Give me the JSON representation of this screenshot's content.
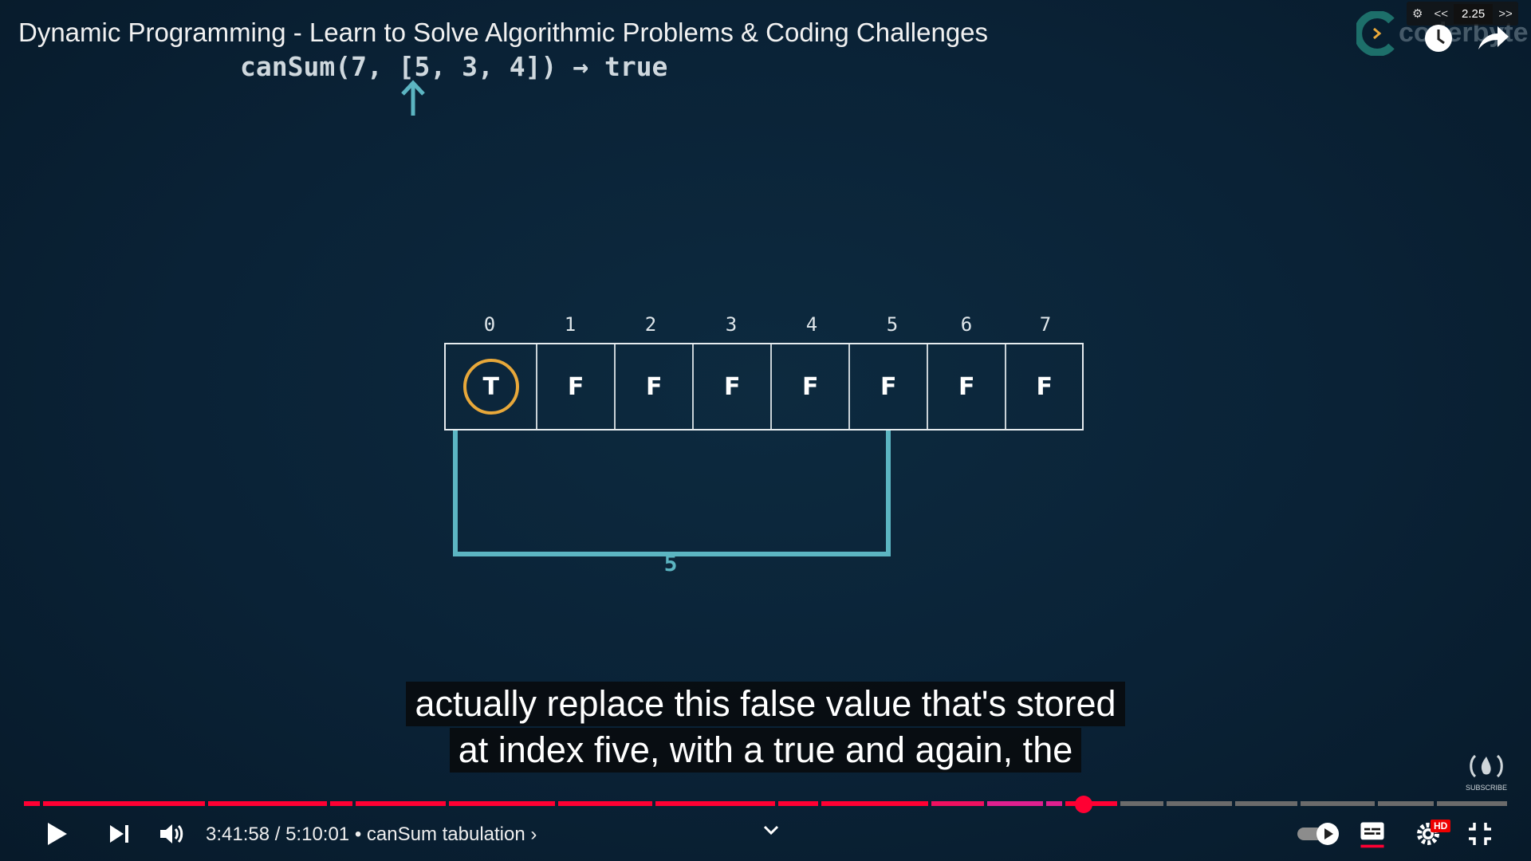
{
  "video": {
    "title": "Dynamic Programming - Learn to Solve Algorithmic Problems & Coding Challenges"
  },
  "slide": {
    "code": "canSum(7, [5, 3, 4]) → true",
    "indices": [
      "0",
      "1",
      "2",
      "3",
      "4",
      "5",
      "6",
      "7"
    ],
    "cells": [
      "T",
      "F",
      "F",
      "F",
      "F",
      "F",
      "F",
      "F"
    ],
    "highlighted_cell": 0,
    "bracket_label": "5",
    "colors": {
      "highlight_ring": "#e8a83a",
      "bracket": "#5cb5c2"
    }
  },
  "overlay": {
    "brand": "coderbyte",
    "speed": {
      "decrease": "<<",
      "value": "2.25",
      "increase": ">>"
    }
  },
  "captions": {
    "line1": "actually replace this false value that's stored",
    "line2": "at index five, with a true and again, the"
  },
  "watermark": {
    "label": "SUBSCRIBE"
  },
  "player": {
    "time": "3:41:58 / 5:10:01",
    "separator": "•",
    "chapter": "canSum tabulation",
    "chapter_arrow": "›",
    "progress_fraction": 0.7146,
    "settings_badge": "HD",
    "progress_color": "#ff0033",
    "icons": [
      "play-icon",
      "next-icon",
      "volume-icon",
      "chevron-down-icon",
      "autoplay-toggle",
      "subtitles-icon",
      "settings-icon",
      "exit-fullscreen-icon"
    ]
  }
}
